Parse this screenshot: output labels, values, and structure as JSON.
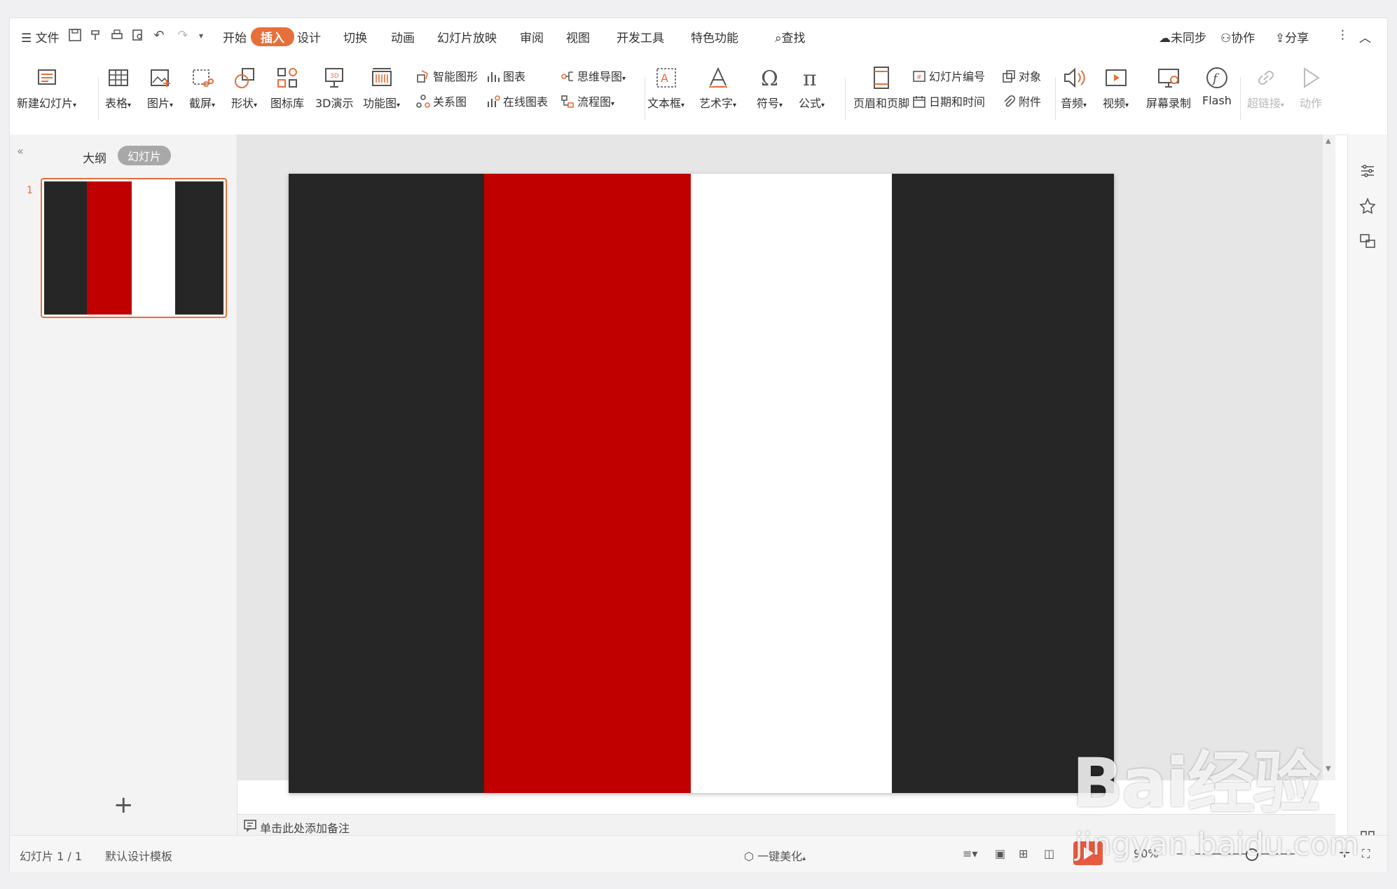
{
  "menu": {
    "file": "文件",
    "tabs": [
      "开始",
      "插入",
      "设计",
      "切换",
      "动画",
      "幻灯片放映",
      "审阅",
      "视图",
      "开发工具",
      "特色功能"
    ],
    "active_tab": "插入",
    "search": "查找",
    "right": {
      "sync": "未同步",
      "collab": "协作",
      "share": "分享"
    }
  },
  "ribbon": {
    "new_slide": "新建幻灯片",
    "table": "表格",
    "picture": "图片",
    "screenshot": "截屏",
    "shape": "形状",
    "icon_lib": "图标库",
    "demo3d": "3D演示",
    "func_chart": "功能图",
    "smart_art": "智能图形",
    "chart": "图表",
    "mindmap": "思维导图",
    "relation": "关系图",
    "online_chart": "在线图表",
    "flowchart": "流程图",
    "textbox": "文本框",
    "wordart": "艺术字",
    "symbol": "符号",
    "formula": "公式",
    "header_footer": "页眉和页脚",
    "slide_number": "幻灯片编号",
    "object": "对象",
    "datetime": "日期和时间",
    "attachment": "附件",
    "audio": "音频",
    "video": "视频",
    "screen_record": "屏幕录制",
    "flash": "Flash",
    "hyperlink": "超链接",
    "action": "动作"
  },
  "panel": {
    "tab_outline": "大纲",
    "tab_slides": "幻灯片",
    "slide_index": "1"
  },
  "slide": {
    "stripes": [
      {
        "color": "#262626",
        "fraction": 0.237
      },
      {
        "color": "#c00000",
        "fraction": 0.25
      },
      {
        "color": "#ffffff",
        "fraction": 0.244
      },
      {
        "color": "#262626",
        "fraction": 0.269
      }
    ]
  },
  "notes_placeholder": "单击此处添加备注",
  "status": {
    "slide_counter": "幻灯片 1 / 1",
    "template": "默认设计模板",
    "beautify": "一键美化",
    "zoom": "90%"
  },
  "watermark": {
    "brand": "Bai经验",
    "url": "jingyan.baidu.com"
  },
  "colors": {
    "accent": "#e76f3a",
    "dark": "#262626",
    "red": "#c00000"
  }
}
